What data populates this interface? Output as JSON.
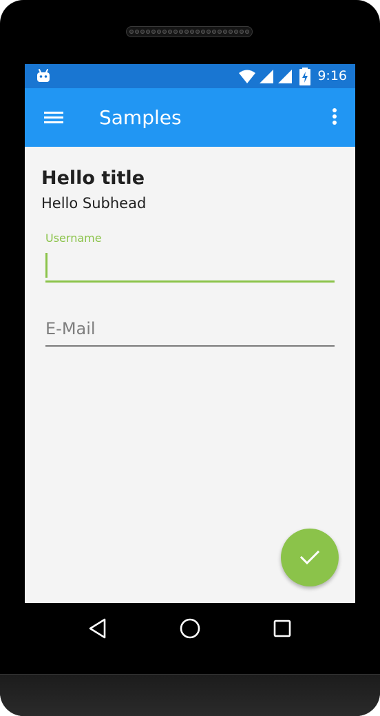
{
  "status_bar": {
    "time": "9:16",
    "icons": [
      "android-robot-icon",
      "wifi-icon",
      "signal-icon",
      "signal-icon",
      "battery-charging-icon"
    ],
    "color": "#1976d2"
  },
  "app_bar": {
    "title": "Samples",
    "menu_icon": "hamburger-menu-icon",
    "overflow_icon": "more-vert-icon",
    "color": "#2196f3"
  },
  "content": {
    "title": "Hello title",
    "subhead": "Hello Subhead"
  },
  "form": {
    "username": {
      "label": "Username",
      "value": ""
    },
    "email": {
      "placeholder": "E-Mail",
      "value": ""
    },
    "accent_color": "#8bc34a"
  },
  "fab": {
    "icon": "check-icon",
    "color": "#8bc34a"
  },
  "nav_bar": {
    "icons": [
      "back-icon",
      "home-icon",
      "recents-icon"
    ]
  }
}
